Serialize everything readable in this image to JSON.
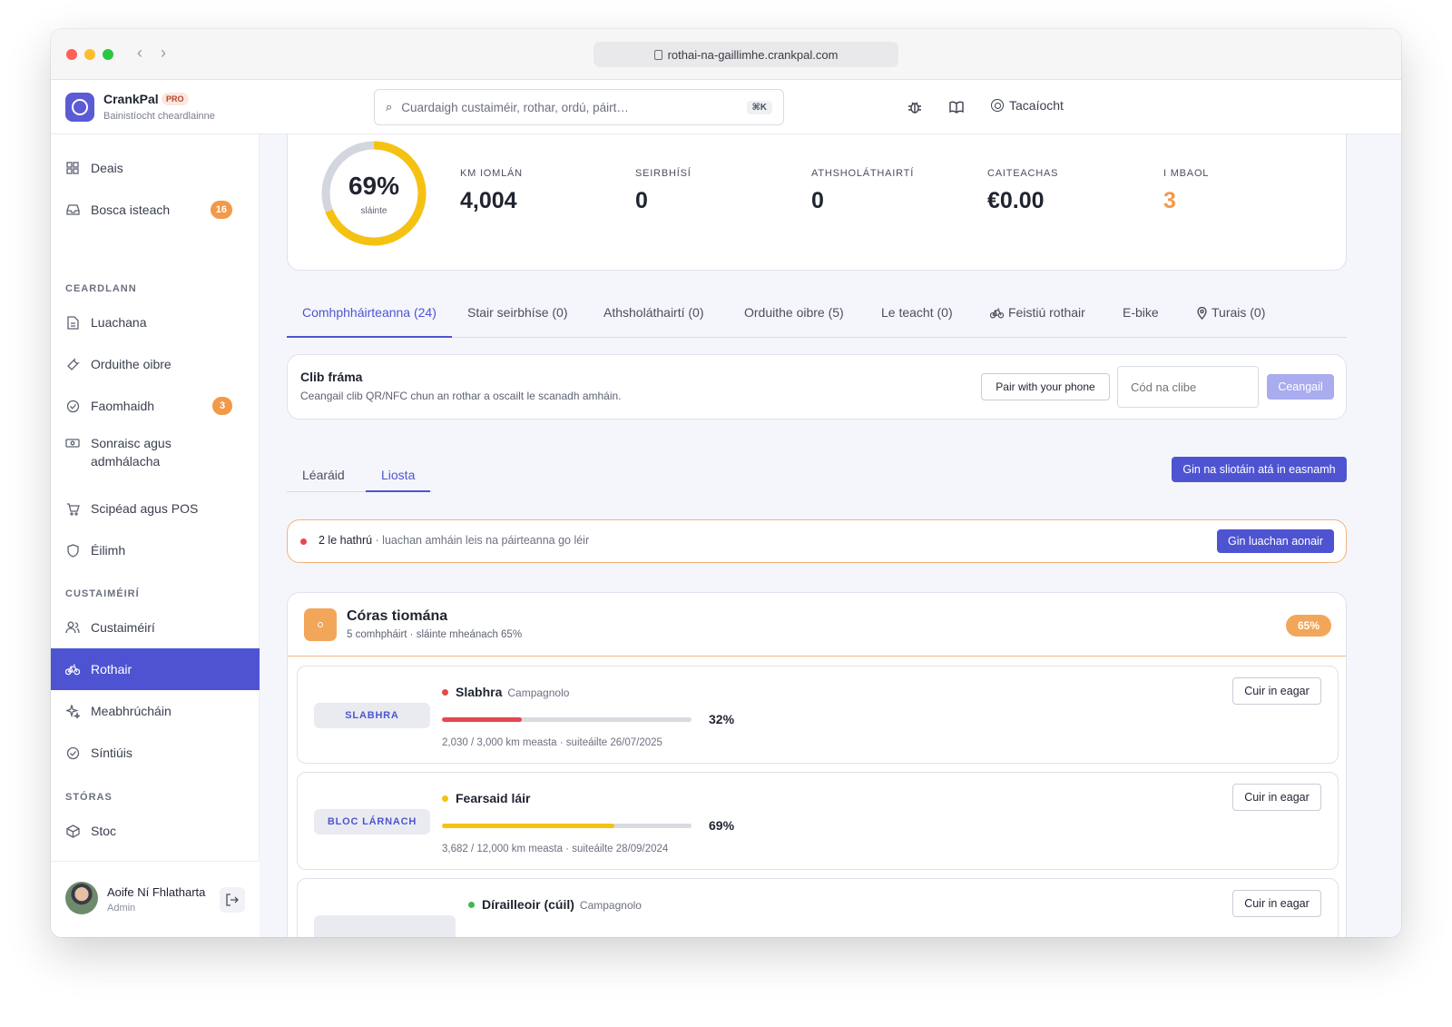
{
  "browser": {
    "url": "rothai-na-gaillimhe.crankpal.com"
  },
  "app": {
    "name": "CrankPal",
    "plan": "PRO",
    "subtitle": "Bainistíocht cheardlainne",
    "search_placeholder": "Cuardaigh custaiméir, rothar, ordú, páirt…",
    "search_shortcut": "⌘K",
    "support_label": "Tacaíocht",
    "accent": "#4e54d1"
  },
  "sidebar": {
    "top_items": [
      {
        "label": "Deais",
        "icon": "grid-icon"
      },
      {
        "label": "Bosca isteach",
        "icon": "inbox-icon",
        "badge": "16"
      }
    ],
    "sections": [
      {
        "label": "CEARDLANN",
        "items": [
          {
            "label": "Luachana",
            "icon": "document-icon"
          },
          {
            "label": "Orduithe oibre",
            "icon": "wrench-icon"
          },
          {
            "label": "Faomhaidh",
            "icon": "check-circle-icon",
            "badge": "3"
          },
          {
            "label": "Sonraisc agus admhálacha",
            "icon": "money-icon"
          },
          {
            "label": "Scipéad agus POS",
            "icon": "cart-icon"
          },
          {
            "label": "Éilimh",
            "icon": "shield-icon"
          }
        ]
      },
      {
        "label": "CUSTAIMÉIRÍ",
        "items": [
          {
            "label": "Custaiméirí",
            "icon": "users-icon"
          },
          {
            "label": "Rothair",
            "icon": "bike-icon",
            "active": true
          },
          {
            "label": "Meabhrúcháin",
            "icon": "sparkle-icon"
          },
          {
            "label": "Síntiúis",
            "icon": "check-circle-icon"
          }
        ]
      },
      {
        "label": "STÓRAS",
        "items": [
          {
            "label": "Stoc",
            "icon": "box-icon"
          }
        ]
      }
    ],
    "user": {
      "name": "Aoife Ní Fhlatharta",
      "role": "Admin"
    }
  },
  "stats": {
    "health_percent": 69,
    "health_value": "69%",
    "health_label": "sláinte",
    "items": [
      {
        "label": "KM IOMLÁN",
        "value": "4,004"
      },
      {
        "label": "SEIRBHÍSÍ",
        "value": "0"
      },
      {
        "label": "ATHSHOLÁTHAIRTÍ",
        "value": "0"
      },
      {
        "label": "CAITEACHAS",
        "value": "€0.00"
      },
      {
        "label": "I MBAOL",
        "value": "3",
        "warn": true
      }
    ]
  },
  "tabs": [
    {
      "label": "Comhphháirteanna (24)",
      "active": true
    },
    {
      "label": "Stair seirbhíse (0)"
    },
    {
      "label": "Athsholáthairtí (0)"
    },
    {
      "label": "Orduithe oibre (5)"
    },
    {
      "label": "Le teacht (0)"
    },
    {
      "label": "Feistiú rothair",
      "icon": "bike-icon"
    },
    {
      "label": "E-bike"
    },
    {
      "label": "Turais (0)",
      "icon": "pin-icon"
    }
  ],
  "frame_tag": {
    "title": "Clib fráma",
    "description": "Ceangail clib QR/NFC chun an rothar a oscailt le scanadh amháin.",
    "pair_button": "Pair with your phone",
    "code_placeholder": "Cód na clibe",
    "connect_button": "Ceangail"
  },
  "view_tabs": [
    {
      "label": "Léaráid"
    },
    {
      "label": "Liosta",
      "active": true
    }
  ],
  "generate_missing_button": "Gin na sliotáin atá in easnamh",
  "alert": {
    "count_text": "2 le hathrú",
    "rest_text": " · luachan amháin leis na páirteanna go léir",
    "button": "Gin luachan aonair"
  },
  "group": {
    "title": "Córas tiomána",
    "subtitle": "5 comhpháirt · sláinte mheánach 65%",
    "health": "65%",
    "parts": [
      {
        "tag": "SLABHRA",
        "name": "Slabhra",
        "brand": "Campagnolo",
        "status_color": "#e5484d",
        "health": 32,
        "health_label": "32%",
        "meta": "2,030 / 3,000 km measta · suiteáilte 26/07/2025",
        "edit": "Cuir in eagar"
      },
      {
        "tag": "BLOC LÁRNACH",
        "name": "Fearsaid láir",
        "brand": "",
        "status_color": "#f5c211",
        "health": 69,
        "health_label": "69%",
        "meta": "3,682 / 12,000 km measta · suiteáilte 28/09/2024",
        "edit": "Cuir in eagar"
      },
      {
        "tag": "",
        "name": "Dírailleoir (cúil)",
        "brand": "Campagnolo",
        "status_color": "#3fb950",
        "health": 0,
        "health_label": "",
        "meta": "",
        "edit": "Cuir in eagar"
      }
    ]
  }
}
